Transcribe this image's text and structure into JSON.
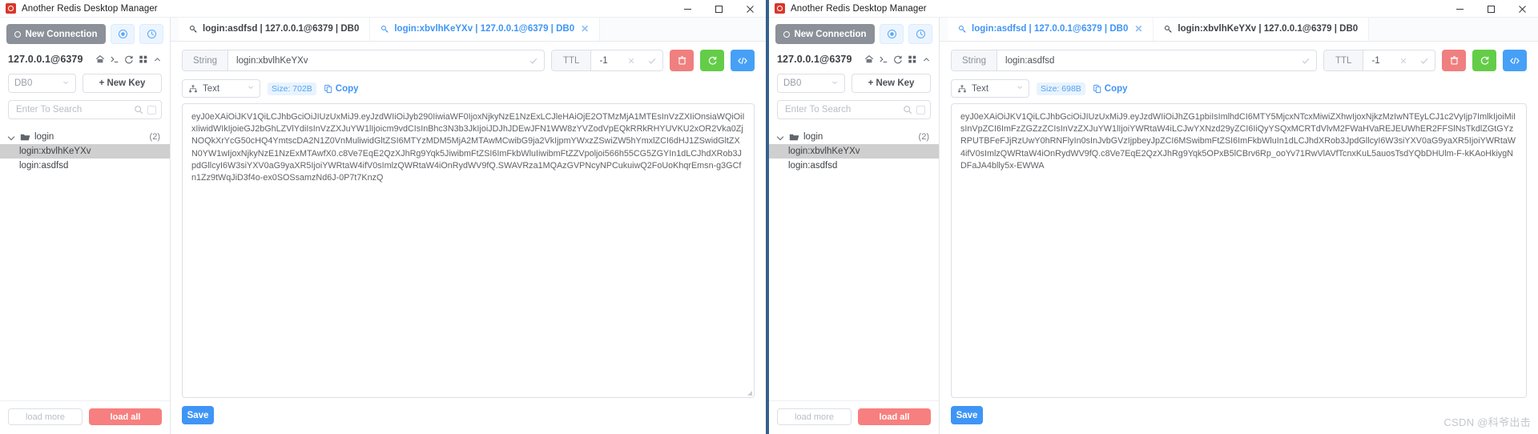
{
  "window_title": "Another Redis Desktop Manager",
  "window_controls": {
    "minimize": "minimize-icon",
    "maximize": "maximize-icon",
    "close": "close-icon"
  },
  "sidebar": {
    "new_connection_label": "New Connection",
    "connection_name": "127.0.0.1@6379",
    "db_select_value": "DB0",
    "new_key_label": "+ New Key",
    "search_placeholder": "Enter To Search",
    "tree": {
      "folder_label": "login",
      "folder_count": "(2)",
      "keys": [
        {
          "label": "login:xbvlhKeYXv",
          "selected_left": true,
          "selected_right": true
        },
        {
          "label": "login:asdfsd",
          "selected_left": false,
          "selected_right": false
        }
      ]
    },
    "load_more_label": "load more",
    "load_all_label": "load all"
  },
  "left_window": {
    "tabs": [
      {
        "label": "login:asdfsd | 127.0.0.1@6379 | DB0",
        "active": false,
        "closable": false
      },
      {
        "label": "login:xbvlhKeYXv | 127.0.0.1@6379 | DB0",
        "active": true,
        "closable": true
      }
    ],
    "key_type_label": "String",
    "key_name": "login:xbvlhKeYXv",
    "ttl_label": "TTL",
    "ttl_value": "-1",
    "format_label": "Text",
    "size_badge": "Size: 702B",
    "copy_label": "Copy",
    "value": "eyJ0eXAiOiJKV1QiLCJhbGciOiJIUzUxMiJ9.eyJzdWIiOiJyb290IiwiaWF0IjoxNjkyNzE1NzExLCJleHAiOjE2OTMzMjA1MTEsInVzZXIiOnsiaWQiOiIxIiwidWIkIjoieGJ2bGhLZVlYdiIsInVzZXJuYW1lIjoicm9vdCIsInBhc3N3b3JkIjoiJDJhJDEwJFN1WW8zYVZodVpEQkRRkRHYUVKU2xOR2Vka0ZjNOQkXrYcG50cHQ4YmtscDA2N1Z0VnMuliwidGltZSI6MTYzMDM5MjA2MTAwMCwibG9ja2VkIjpmYWxzZSwiZW5hYmxlZCI6dHJ1ZSwidGltZXN0YW1wIjoxNjkyNzE1NzExMTAwfX0.c8Ve7EqE2QzXJhRg9Yqk5JiwibmFtZSI6ImFkbWluIiwibmFtZZVpoljoi566h55CG5ZGYIn1dLCJhdXRob3JpdGllcyI6W3siYXV0aG9yaXR5IjoiYWRtaW4ifV0sImlzQWRtaW4iOnRydWV9fQ.SWAVRza1MQAzGVPNcyNPCukuiwQ2FoUoKhqrEmsn-g3GCfn1Zz9tWqJiD3f4o-ex0SOSsamzNd6J-0P7t7KnzQ"
  },
  "right_window": {
    "tabs": [
      {
        "label": "login:asdfsd | 127.0.0.1@6379 | DB0",
        "active": true,
        "closable": true
      },
      {
        "label": "login:xbvlhKeYXv | 127.0.0.1@6379 | DB0",
        "active": false,
        "closable": false
      }
    ],
    "key_type_label": "String",
    "key_name": "login:asdfsd",
    "ttl_label": "TTL",
    "ttl_value": "-1",
    "format_label": "Text",
    "size_badge": "Size: 698B",
    "copy_label": "Copy",
    "value": "eyJ0eXAiOiJKV1QiLCJhbGciOiJIUzUxMiJ9.eyJzdWIiOiJhZG1pbiIsImlhdCI6MTY5MjcxNTcxMiwiZXhwIjoxNjkzMzIwNTEyLCJ1c2VyIjp7ImlkIjoiMiIsInVpZCI6ImFzZGZzZCIsInVzZXJuYW1lIjoiYWRtaW4iLCJwYXNzd29yZCI6IiQyYSQxMCRTdVlvM2FWaHVaREJEUWhER2FFSlNsTkdlZGtGYzRPUTBFeFJjRzUwY0hRNFlyIn0sInJvbGVzIjpbeyJpZCI6MSwibmFtZSI6ImFkbWluIn1dLCJhdXRob3JpdGllcyI6W3siYXV0aG9yaXR5IjoiYWRtaW4ifV0sImlzQWRtaW4iOnRydWV9fQ.c8Ve7EqE2QzXJhRg9Yqk5OPxB5lCBrv6Rp_ooYv71RwVlAVfTcnxKuL5auosTsdYQbDHUlm-F-kKAoHkiygNDFaJA4blly5x-EWWA"
  },
  "save_label": "Save",
  "watermark": "CSDN @科爷出击",
  "colors": {
    "accent_blue": "#3f95f5",
    "danger_red": "#f07f7f",
    "success_green": "#63cd48",
    "sidebar_btn_gray": "#8b9099"
  }
}
